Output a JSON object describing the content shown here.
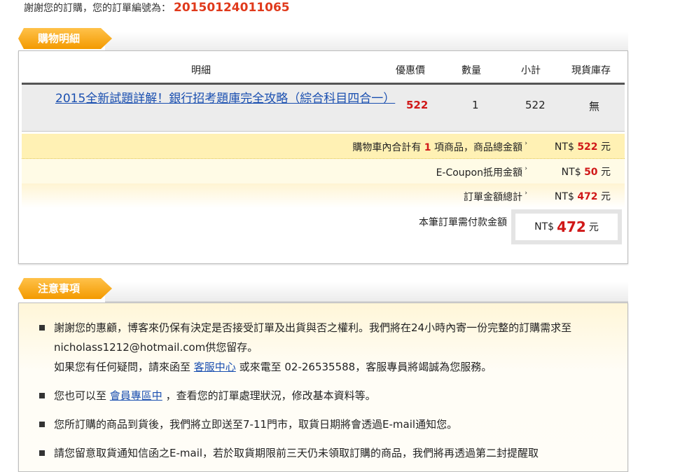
{
  "order": {
    "prefix": "謝謝您的訂購，您的訂單編號為：",
    "number": "20150124011065"
  },
  "cart_section": {
    "title": "購物明細"
  },
  "table": {
    "headers": {
      "detail": "明細",
      "price": "優惠價",
      "qty": "數量",
      "subtotal": "小計",
      "stock": "現貨庫存"
    },
    "rows": [
      {
        "title": "2015全新試題詳解！銀行招考題庫完全攻略（綜合科目四合一）",
        "price": "522",
        "qty": "1",
        "subtotal": "522",
        "stock": "無"
      }
    ]
  },
  "summary": {
    "count_prefix": "購物車內合計有",
    "count": "1",
    "count_suffix": "項商品，商品總金額",
    "total_currency": "NT$",
    "total": "522",
    "unit": "元",
    "coupon_label": "E-Coupon抵用金額",
    "coupon_currency": "NT$",
    "coupon": "50",
    "order_total_label": "訂單金額總計",
    "order_total_currency": "NT$",
    "order_total": "472",
    "pay_label": "本筆訂單需付款金額",
    "pay_currency": "NT$",
    "pay_amount": "472",
    "arrow": "›"
  },
  "notes_section": {
    "title": "注意事項",
    "n1_a": "謝謝您的惠顧，博客來仍保有決定是否接受訂單及出貨與否之權利。我們將在24小時內寄一份完整的訂購需求至nicholass1212@hotmail.com供您留存。",
    "n1_b_pre": "如果您有任何疑問，請來函至",
    "n1_b_link": "客服中心",
    "n1_b_post": "或來電至 02-26535588，客服專員將竭誠為您服務。",
    "n2_pre": "您也可以至",
    "n2_link": "會員專區中",
    "n2_post": "，查看您的訂單處理狀況，修改基本資料等。",
    "n3": "您所訂購的商品到貨後，我們將立即送至7-11門市，取貨日期將會透過E-mail通知您。",
    "n4": "請您留意取貨通知信函之E-mail，若於取貨期限前三天仍未領取訂購的商品，我們將再透過第二封提醒取"
  }
}
